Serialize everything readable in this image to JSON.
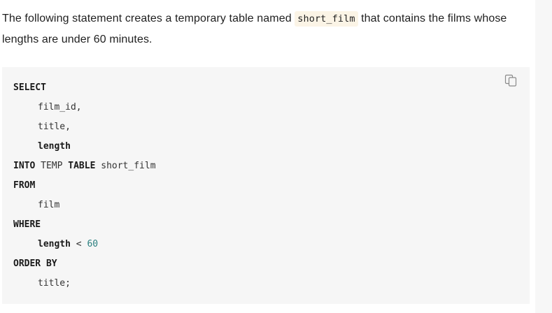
{
  "intro": {
    "before": "The following statement creates a temporary table named ",
    "inline_code": "short_film",
    "after": " that contains the films whose lengths are under 60 minutes."
  },
  "code": {
    "select": "SELECT",
    "col1": "film_id,",
    "col2": "title,",
    "col3": "length",
    "into": "INTO",
    "temp": " TEMP ",
    "table": "TABLE",
    "table_name": " short_film",
    "from": "FROM",
    "from_table": "film",
    "where": "WHERE",
    "where_col": "length",
    "where_op": " < ",
    "where_val": "60",
    "order_by": "ORDER BY",
    "order_col": "title;"
  },
  "icons": {
    "copy": "copy-icon"
  }
}
